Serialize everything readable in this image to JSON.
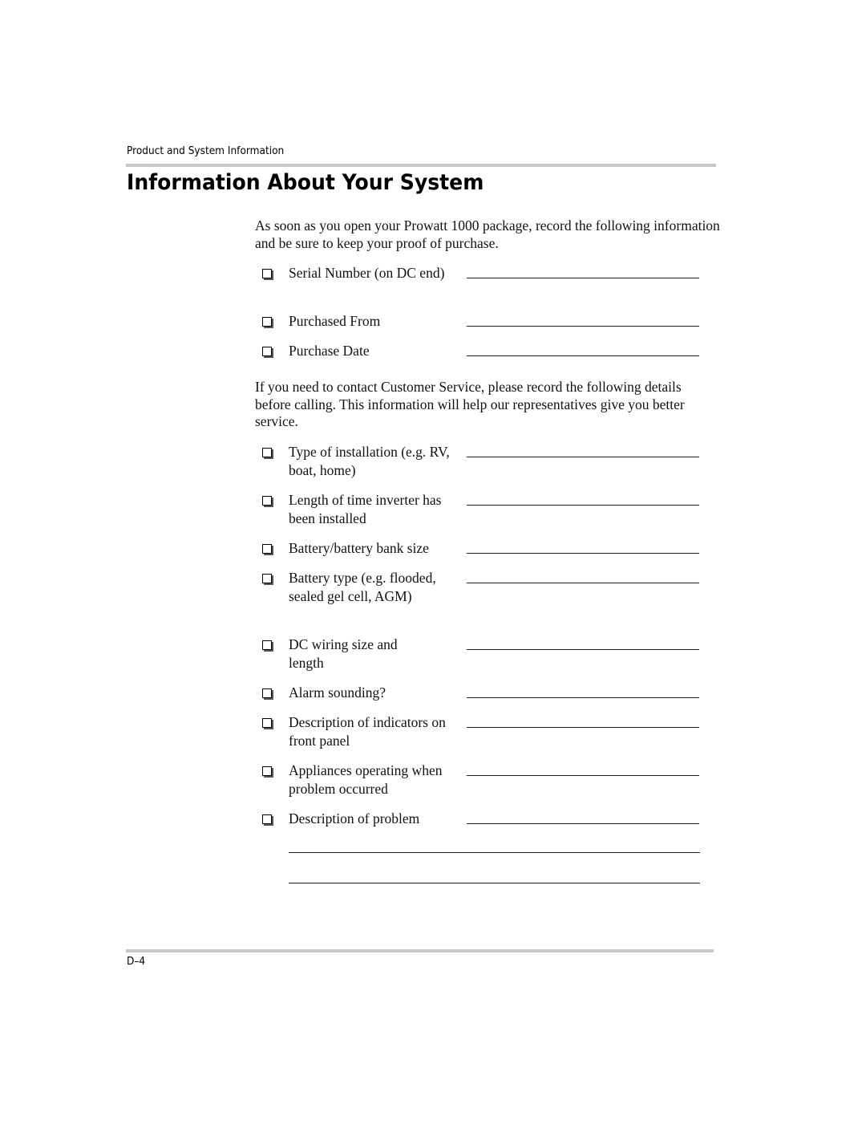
{
  "header": {
    "running_title": "Product and System Information"
  },
  "title": "Information About Your System",
  "section1": {
    "intro": "As soon as you open your Prowatt 1000 package, record the following information and be sure to keep your proof of purchase.",
    "items": [
      {
        "label": "Serial Number (on DC end)",
        "value": ""
      },
      {
        "label": "Purchased From",
        "value": ""
      },
      {
        "label": "Purchase Date",
        "value": ""
      }
    ]
  },
  "section2": {
    "intro": "If you need to contact Customer Service, please record the following details before calling. This information will help our representatives give you better service.",
    "items": [
      {
        "label": "Type of installation (e.g. RV, boat, home)",
        "value": ""
      },
      {
        "label": "Length of time inverter has been installed",
        "value": ""
      },
      {
        "label": "Battery/battery bank size",
        "value": ""
      },
      {
        "label": "Battery type (e.g. flooded, sealed gel cell, AGM)",
        "value": ""
      },
      {
        "label": "DC wiring size and length",
        "value": ""
      },
      {
        "label": "Alarm sounding?",
        "value": ""
      },
      {
        "label": "Description of indicators on front panel",
        "value": ""
      },
      {
        "label": "Appliances operating when problem occurred",
        "value": ""
      },
      {
        "label": "Description of problem",
        "value": ""
      }
    ],
    "extra_lines": [
      "",
      ""
    ]
  },
  "footer": {
    "page_number": "D–4"
  },
  "icons": {
    "checkbox": "shadowed-checkbox-icon"
  },
  "colors": {
    "rule": "#c8c8c8",
    "text": "#000000"
  }
}
